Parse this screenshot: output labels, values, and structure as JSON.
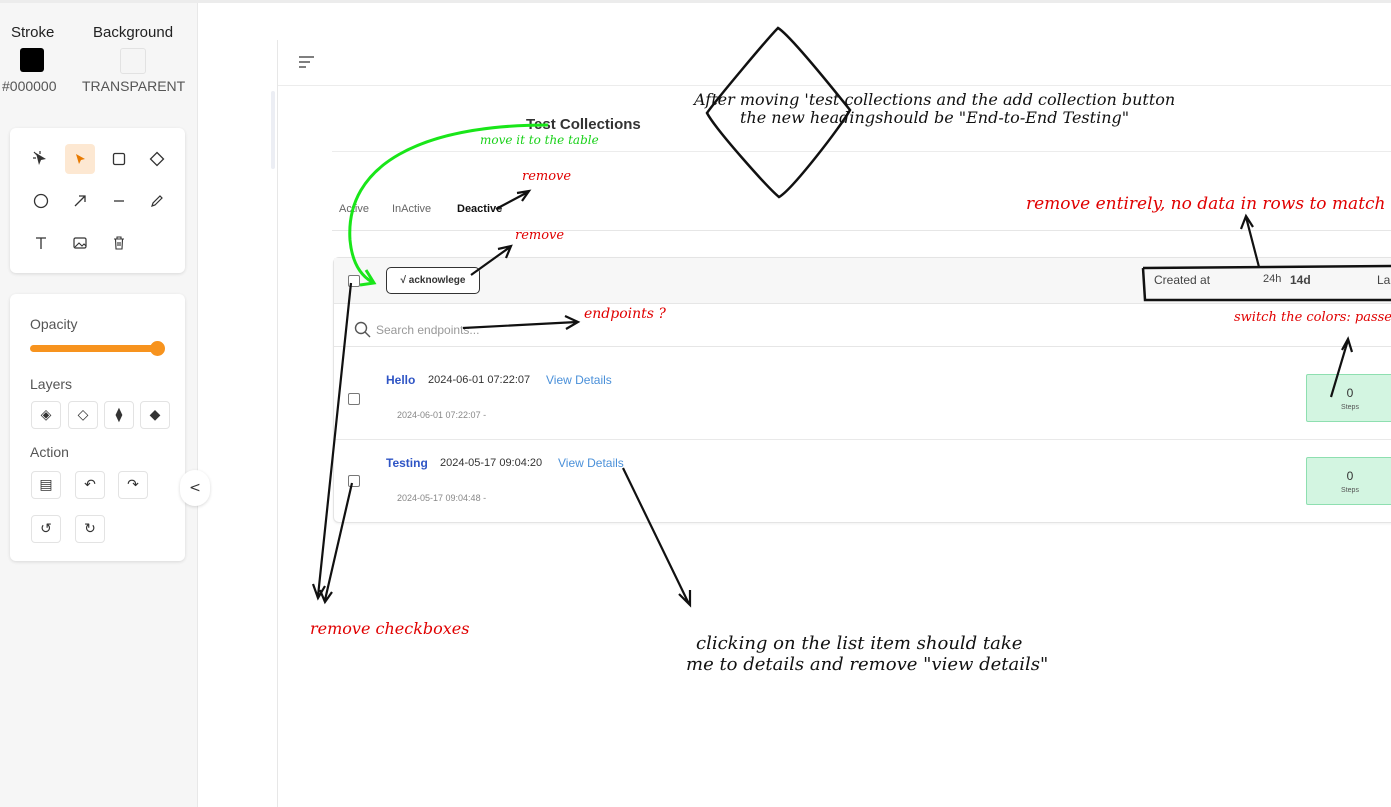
{
  "sidebar": {
    "stroke_label": "Stroke",
    "background_label": "Background",
    "stroke_value": "#000000",
    "background_value": "TRANSPARENT",
    "stroke_color": "#000000",
    "tools": [
      "selection-icon",
      "pointer-icon",
      "rectangle-icon",
      "diamond-icon",
      "circle-icon",
      "arrow-icon",
      "line-icon",
      "pencil-icon",
      "text-icon",
      "image-icon",
      "trash-icon"
    ],
    "opacity_label": "Opacity",
    "opacity_value": 1.0,
    "opacity_color": "#f7931e",
    "layers_label": "Layers",
    "action_label": "Action",
    "collapse_glyph": "<"
  },
  "app": {
    "title": "Test Collections",
    "tabs": [
      "Active",
      "InActive",
      "Deactive"
    ],
    "active_tab": "Deactive",
    "toolbar": {
      "ack_label": "√ acknowlege"
    },
    "header": {
      "created_at": "Created at",
      "range_24h": "24h",
      "range_14d": "14d",
      "last_partial": "La"
    },
    "search": {
      "placeholder": "Search endpoints..."
    },
    "rows": [
      {
        "name": "Hello",
        "date": "2024-06-01 07:22:07",
        "link": "View Details",
        "sub": "2024-06-01 07:22:07  -",
        "steps_count": "0",
        "steps_label": "Steps"
      },
      {
        "name": "Testing",
        "date": "2024-05-17 09:04:20",
        "link": "View Details",
        "sub": "2024-05-17 09:04:48  -",
        "steps_count": "0",
        "steps_label": "Steps"
      }
    ]
  },
  "annotations": {
    "diamond_note_line1": "After moving 'test collections and the add collection button",
    "diamond_note_line2": "the new headingshould be \"End-to-End Testing\"",
    "move_to_table": "move it to the table",
    "remove_tabs": "remove",
    "remove_ack": "remove",
    "remove_entirely": "remove entirely, no data in rows to match",
    "endpoints_q": "endpoints ?",
    "switch_colors": "switch the colors: passed",
    "remove_checkboxes": "remove checkboxes",
    "click_note_line1": "clicking on the list item should take",
    "click_note_line2": "me to details and remove \"view details\""
  }
}
